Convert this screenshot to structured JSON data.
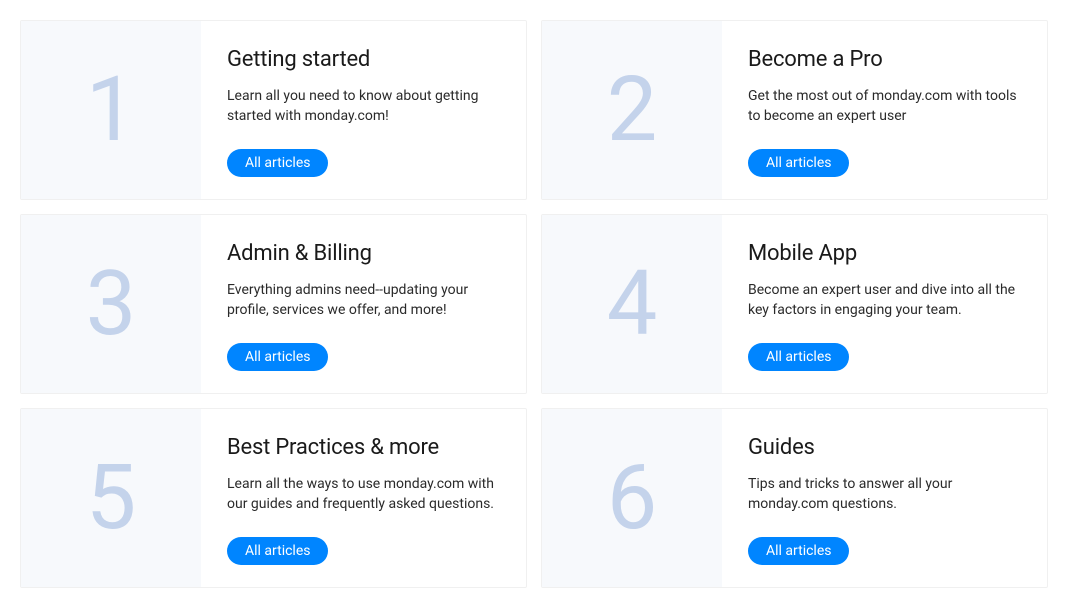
{
  "cards": [
    {
      "number": "1",
      "title": "Getting started",
      "description": "Learn all you need to know about getting started with monday.com!",
      "button_label": "All articles"
    },
    {
      "number": "2",
      "title": "Become a Pro",
      "description": "Get the most out of monday.com with tools to become an expert user",
      "button_label": "All articles"
    },
    {
      "number": "3",
      "title": "Admin & Billing",
      "description": "Everything admins need--updating your profile, services we offer, and more!",
      "button_label": "All articles"
    },
    {
      "number": "4",
      "title": "Mobile App",
      "description": "Become an expert user and dive into all the key factors in engaging your team.",
      "button_label": "All articles"
    },
    {
      "number": "5",
      "title": "Best Practices & more",
      "description": "Learn all the ways to use monday.com with our guides and frequently asked questions.",
      "button_label": "All articles"
    },
    {
      "number": "6",
      "title": "Guides",
      "description": "Tips and tricks to answer all your monday.com questions.",
      "button_label": "All articles"
    }
  ]
}
